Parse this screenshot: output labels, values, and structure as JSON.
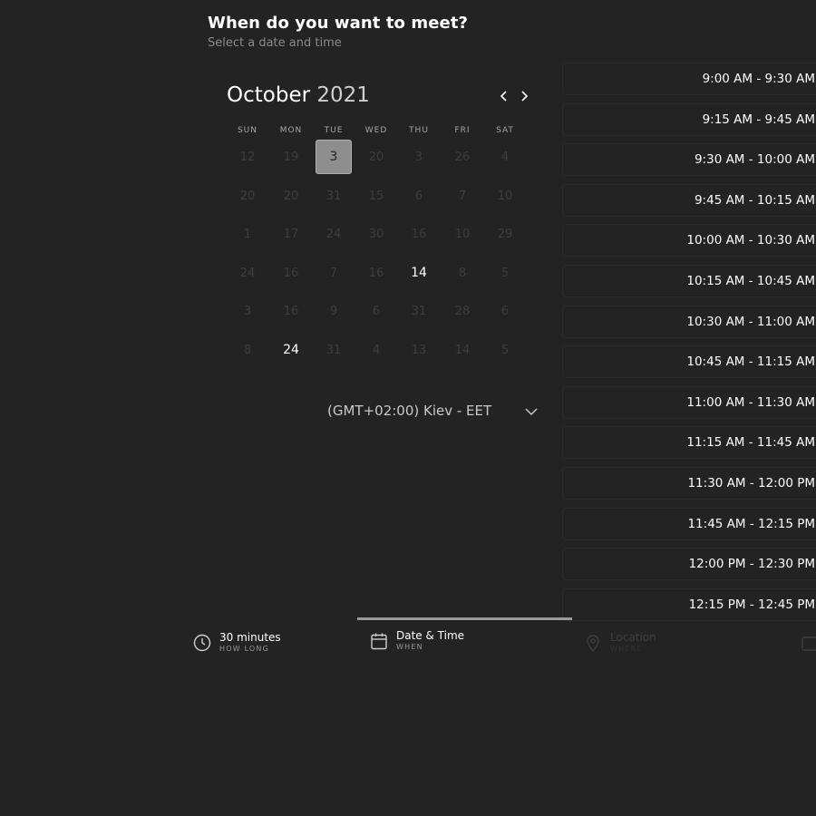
{
  "header": {
    "title": "When do you want to meet?",
    "subtitle": "Select a date and time"
  },
  "calendar": {
    "month": "October",
    "year": "2021",
    "weekdays": [
      "SUN",
      "MON",
      "TUE",
      "WED",
      "THU",
      "FRI",
      "SAT"
    ],
    "rows": [
      [
        "12",
        "19",
        "3",
        "20",
        "3",
        "26",
        "4"
      ],
      [
        "20",
        "20",
        "31",
        "15",
        "6",
        "7",
        "10"
      ],
      [
        "1",
        "17",
        "24",
        "30",
        "16",
        "10",
        "29"
      ],
      [
        "24",
        "16",
        "7",
        "16",
        "14",
        "8",
        "5"
      ],
      [
        "3",
        "16",
        "9",
        "6",
        "31",
        "28",
        "6"
      ],
      [
        "8",
        "24",
        "31",
        "4",
        "13",
        "14",
        "5"
      ]
    ],
    "selected": "3",
    "available": [
      "14",
      "24"
    ]
  },
  "timezone": {
    "label": "(GMT+02:00) Kiev - EET"
  },
  "slots": [
    "9:00 AM - 9:30 AM",
    "9:15 AM - 9:45 AM",
    "9:30 AM - 10:00 AM",
    "9:45 AM - 10:15 AM",
    "10:00 AM - 10:30 AM",
    "10:15 AM - 10:45 AM",
    "10:30 AM - 11:00 AM",
    "10:45 AM - 11:15 AM",
    "11:00 AM - 11:30 AM",
    "11:15 AM - 11:45 AM",
    "11:30 AM - 12:00 PM",
    "11:45 AM - 12:15 PM",
    "12:00 PM - 12:30 PM",
    "12:15 PM - 12:45 PM"
  ],
  "steps": [
    {
      "label": "30 minutes",
      "sub": "HOW LONG",
      "icon": "clock-icon",
      "state": "done"
    },
    {
      "label": "Date & Time",
      "sub": "WHEN",
      "icon": "calendar-icon",
      "state": "active"
    },
    {
      "label": "Location",
      "sub": "WHERE",
      "icon": "map-pin-icon",
      "state": "pending"
    },
    {
      "label": "",
      "sub": "",
      "icon": "details-icon",
      "state": "pending"
    }
  ]
}
